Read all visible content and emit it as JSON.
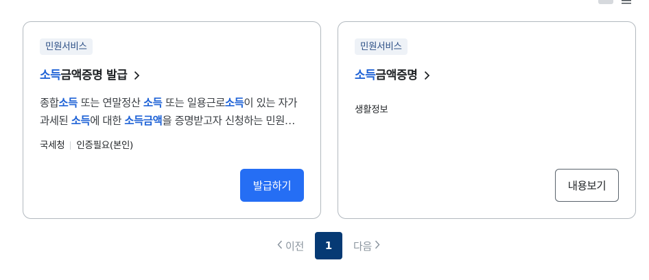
{
  "view_toggle": {
    "grid_icon": "grid-view-icon",
    "list_icon": "list-view-icon"
  },
  "cards": [
    {
      "badge": "민원서비스",
      "title_highlight": "소득",
      "title_rest": "금액증명 발급",
      "description_parts": [
        {
          "text": "종합",
          "hl": false
        },
        {
          "text": "소득",
          "hl": true
        },
        {
          "text": " 또는 연말정산 ",
          "hl": false
        },
        {
          "text": "소득",
          "hl": true
        },
        {
          "text": " 또는 일용근로",
          "hl": false
        },
        {
          "text": "소득",
          "hl": true
        },
        {
          "text": "이 있는 자가 과세된 ",
          "hl": false
        },
        {
          "text": "소득",
          "hl": true
        },
        {
          "text": "에 대한 ",
          "hl": false
        },
        {
          "text": "소득금액",
          "hl": true
        },
        {
          "text": "을 증명받고자 신청하는 민원입니다.",
          "hl": false
        }
      ],
      "meta_agency": "국세청",
      "meta_auth": "인증필요(본인)",
      "button_label": "발급하기"
    },
    {
      "badge": "민원서비스",
      "title_highlight": "소득",
      "title_rest": "금액증명",
      "category": "생활정보",
      "button_label": "내용보기"
    }
  ],
  "pagination": {
    "prev_label": "이전",
    "current_page": "1",
    "next_label": "다음"
  },
  "colors": {
    "highlight": "#1e62d6",
    "primary_button": "#256ef4",
    "current_page": "#063a74",
    "badge_bg": "#eef2f7"
  }
}
